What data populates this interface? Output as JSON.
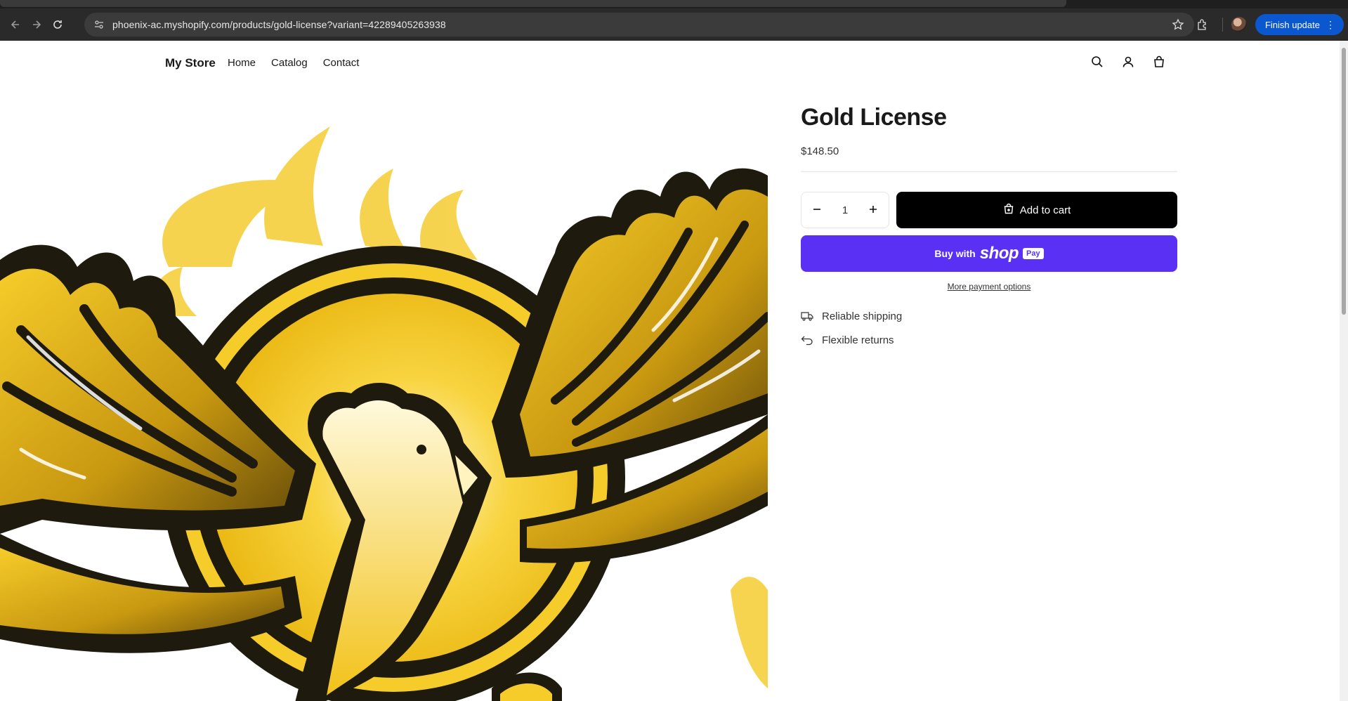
{
  "browser": {
    "url": "phoenix-ac.myshopify.com/products/gold-license?variant=42289405263938",
    "finish_update_label": "Finish update"
  },
  "store": {
    "name": "My Store",
    "nav": [
      "Home",
      "Catalog",
      "Contact"
    ]
  },
  "product": {
    "title": "Gold License",
    "price": "$148.50",
    "quantity": "1",
    "add_to_cart_label": "Add to cart",
    "buy_with_label": "Buy with",
    "shop_label": "shop",
    "pay_label": "Pay",
    "more_payment_label": "More payment options",
    "features": [
      "Reliable shipping",
      "Flexible returns"
    ]
  },
  "colors": {
    "accent_shoppay": "#5a31f4",
    "cart_button": "#000000",
    "phoenix_gold": "#f2c21a",
    "phoenix_dark": "#1e1a0e"
  }
}
